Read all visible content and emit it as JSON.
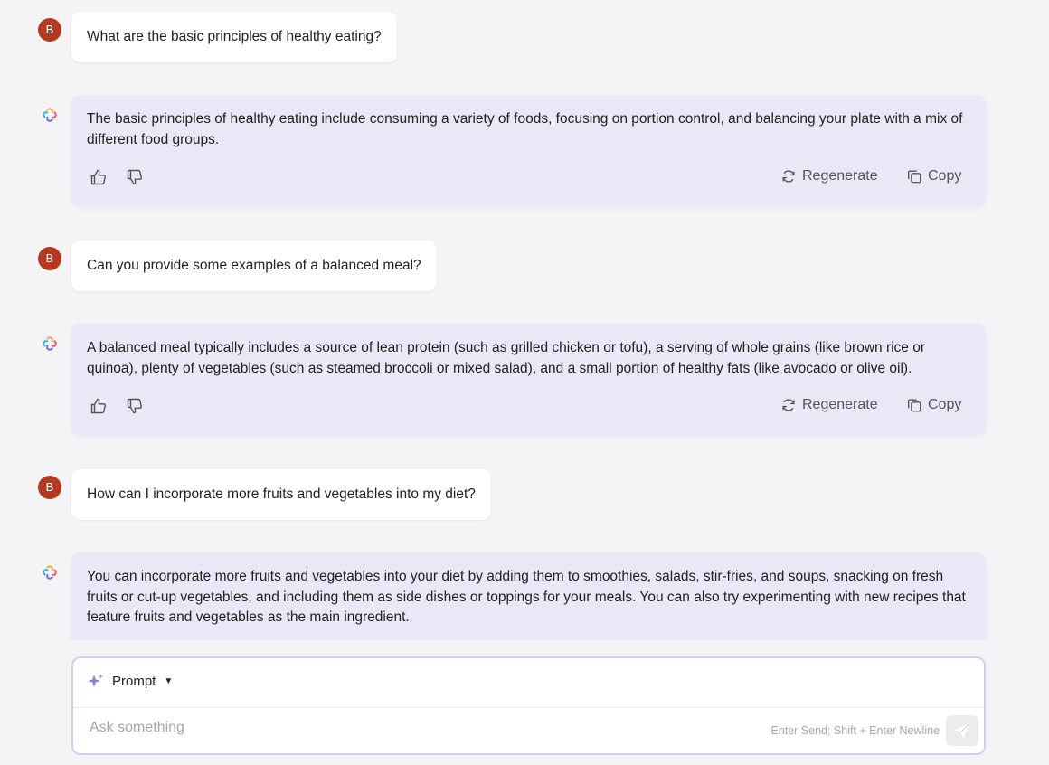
{
  "conversation": {
    "messages": [
      {
        "role": "user",
        "avatar_letter": "B",
        "text": "What are the basic principles of healthy eating?"
      },
      {
        "role": "assistant",
        "text": "The basic principles of healthy eating include consuming a variety of foods, focusing on portion control, and balancing your plate with a mix of different food groups."
      },
      {
        "role": "user",
        "avatar_letter": "B",
        "text": "Can you provide some examples of a balanced meal?"
      },
      {
        "role": "assistant",
        "text": "A balanced meal typically includes a source of lean protein (such as grilled chicken or tofu), a serving of whole grains (like brown rice or quinoa), plenty of vegetables (such as steamed broccoli or mixed salad), and a small portion of healthy fats (like avocado or olive oil)."
      },
      {
        "role": "user",
        "avatar_letter": "B",
        "text": "How can I incorporate more fruits and vegetables into my diet?"
      },
      {
        "role": "assistant",
        "text": "You can incorporate more fruits and vegetables into your diet by adding them to smoothies, salads, stir-fries, and soups, snacking on fresh fruits or cut-up vegetables, and including them as side dishes or toppings for your meals. You can also try experimenting with new recipes that feature fruits and vegetables as the main ingredient."
      }
    ],
    "actions": {
      "regenerate_label": "Regenerate",
      "copy_label": "Copy"
    }
  },
  "composer": {
    "prompt_label": "Prompt",
    "placeholder": "Ask something",
    "hint": "Enter Send; Shift + Enter Newline"
  },
  "colors": {
    "avatar": "#b5391f",
    "assistant_bubble": "#e8e8f6",
    "user_bubble": "#ffffff",
    "composer_border": "#c9d3ee",
    "background": "#f4f4f7"
  }
}
